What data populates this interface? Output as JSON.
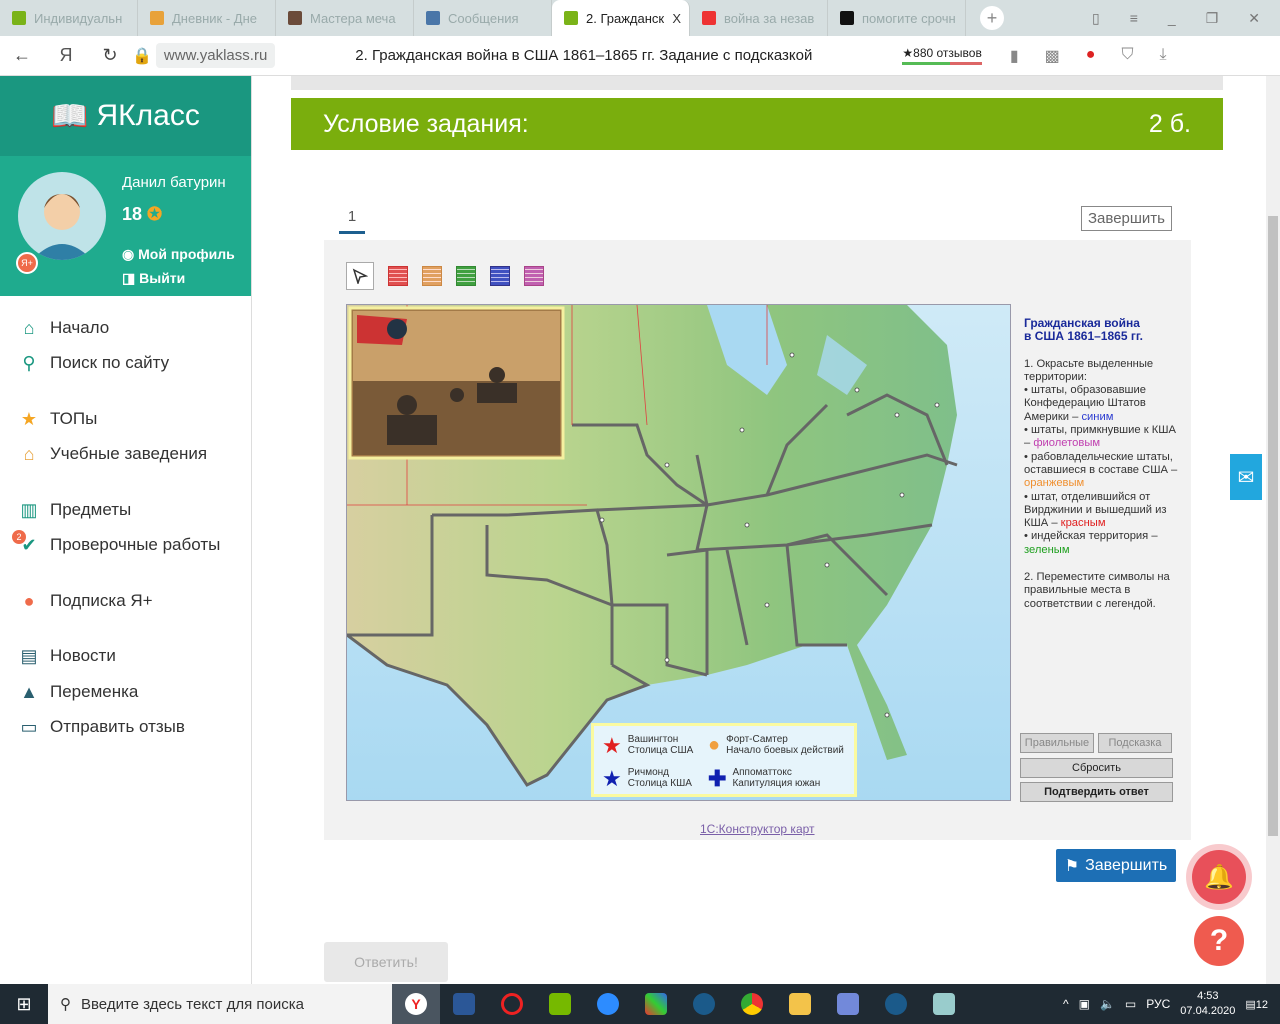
{
  "browser": {
    "tabs": [
      {
        "label": "Индивидуальн",
        "color": "#7ab318"
      },
      {
        "label": "Дневник - Дне",
        "color": "#e8a23a"
      },
      {
        "label": "Мастера меча",
        "color": "#6b4b3a"
      },
      {
        "label": "Сообщения",
        "color": "#4a76a8"
      },
      {
        "label": "2. Гражданск",
        "color": "#7ab318",
        "active": true
      },
      {
        "label": "война за незав",
        "color": "#e33"
      },
      {
        "label": "помогите срочн",
        "color": "#111"
      }
    ],
    "close": "X",
    "url": "www.yaklass.ru",
    "page_title": "2. Гражданская война в США 1861–1865 гг. Задание с подсказкой",
    "reviews": "★880 отзывов"
  },
  "sidebar": {
    "logo": "ЯКласс",
    "user": {
      "name": "Данил батурин",
      "points": "18",
      "profile": "Мой профиль",
      "logout": "Выйти"
    },
    "items": [
      {
        "label": "Начало",
        "icon": "home-icon",
        "glyph": "⌂"
      },
      {
        "label": "Поиск по сайту",
        "icon": "search-icon",
        "glyph": "⚲"
      },
      {
        "label": "ТОПы",
        "icon": "star-icon",
        "glyph": "★"
      },
      {
        "label": "Учебные заведения",
        "icon": "institution-icon",
        "glyph": "🏛"
      },
      {
        "label": "Предметы",
        "icon": "book-icon",
        "glyph": "▥"
      },
      {
        "label": "Проверочные работы",
        "icon": "check-icon",
        "glyph": "✔",
        "badge": "2"
      },
      {
        "label": "Подписка Я+",
        "icon": "subscription-icon",
        "glyph": "●"
      },
      {
        "label": "Новости",
        "icon": "news-icon",
        "glyph": "▤"
      },
      {
        "label": "Переменка",
        "icon": "bell-icon",
        "glyph": "▲"
      },
      {
        "label": "Отправить отзыв",
        "icon": "feedback-icon",
        "glyph": "▭"
      }
    ]
  },
  "task": {
    "title": "Условие задания:",
    "points": "2 б.",
    "tab": "1",
    "finish": "Завершить",
    "finish_big": "Завершить",
    "answer": "Ответить!",
    "instructions": {
      "heading1": "Гражданская война",
      "heading2": "в США 1861–1865 гг.",
      "p1": "1. Окрасьте выделенные территории:",
      "b1": "• штаты, образовавшие Конфедерацию Штатов Америки – ",
      "c1": "синим",
      "b2": "• штаты, примкнувшие к КША – ",
      "c2": "фиолетовым",
      "b3": "• рабовладельческие штаты, оставшиеся в составе США – ",
      "c3": "оранжевым",
      "b4": "• штат, отделившийся от Вирджинии и вышедший из КША – ",
      "c4": "красным",
      "b5": "• индейская территория – ",
      "c5": "зеленым",
      "p2": "2. Переместите символы на правильные места в соответствии с легендой."
    },
    "legend": [
      {
        "l1": "Вашингтон",
        "l2": "Столица США"
      },
      {
        "l1": "Форт-Самтер",
        "l2": "Начало боевых действий"
      },
      {
        "l1": "Ричмонд",
        "l2": "Столица КША"
      },
      {
        "l1": "Аппоматтокс",
        "l2": "Капитуляция южан"
      }
    ],
    "buttons": {
      "correct": "Правильные",
      "hint": "Подсказка",
      "reset": "Сбросить",
      "confirm": "Подтвердить ответ"
    },
    "constructor_link": "1С:Конструктор карт",
    "palette": [
      "#e05050",
      "#e0a060",
      "#40a040",
      "#4050c0",
      "#c060b0"
    ]
  },
  "taskbar": {
    "search": "Введите здесь текст для поиска",
    "lang": "РУС",
    "time": "4:53",
    "date": "07.04.2020",
    "notif": "12"
  }
}
